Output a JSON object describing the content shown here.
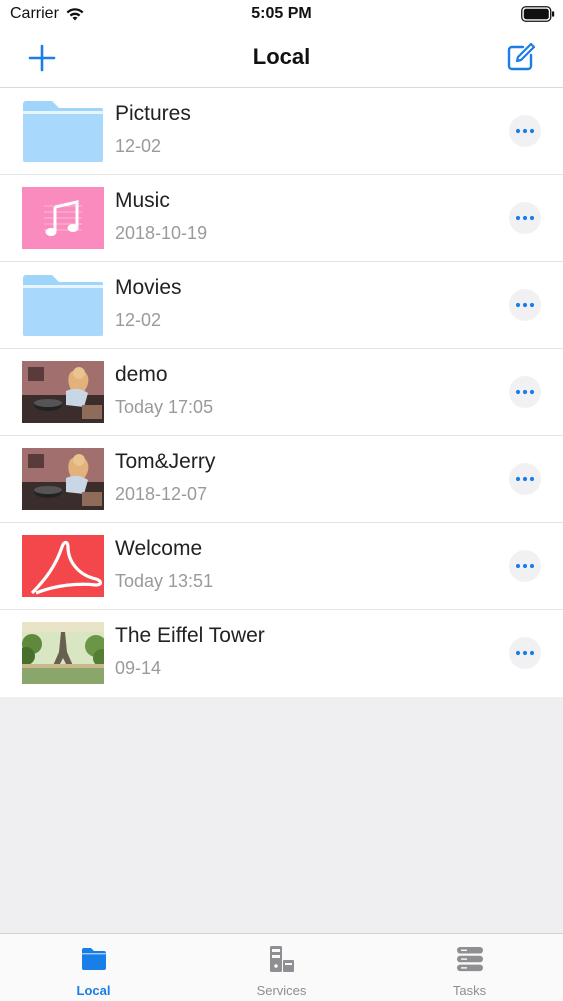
{
  "status_bar": {
    "carrier": "Carrier",
    "time": "5:05 PM"
  },
  "nav": {
    "title": "Local",
    "add_icon": "plus-icon",
    "edit_icon": "compose-icon",
    "accent": "#1a7ee8"
  },
  "items": [
    {
      "title": "Pictures",
      "subtitle": "12-02",
      "thumb": "folder-icon"
    },
    {
      "title": "Music",
      "subtitle": "2018-10-19",
      "thumb": "music-note-icon"
    },
    {
      "title": "Movies",
      "subtitle": "12-02",
      "thumb": "folder-icon"
    },
    {
      "title": "demo",
      "subtitle": "Today 17:05",
      "thumb": "video-thumbnail"
    },
    {
      "title": "Tom&Jerry",
      "subtitle": "2018-12-07",
      "thumb": "video-thumbnail"
    },
    {
      "title": "Welcome",
      "subtitle": "Today 13:51",
      "thumb": "pdf-icon"
    },
    {
      "title": "The Eiffel Tower",
      "subtitle": "09-14",
      "thumb": "photo-thumbnail"
    }
  ],
  "tabs": [
    {
      "label": "Local",
      "icon": "folder-icon",
      "active": true
    },
    {
      "label": "Services",
      "icon": "server-icon",
      "active": false
    },
    {
      "label": "Tasks",
      "icon": "stack-icon",
      "active": false
    }
  ]
}
